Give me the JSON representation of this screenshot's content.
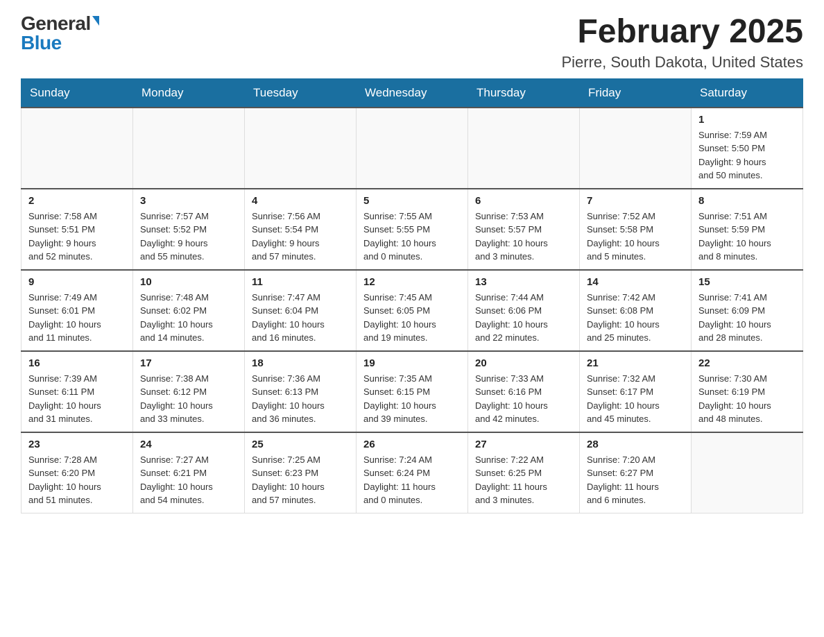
{
  "header": {
    "logo_general": "General",
    "logo_blue": "Blue",
    "title": "February 2025",
    "subtitle": "Pierre, South Dakota, United States"
  },
  "days_of_week": [
    "Sunday",
    "Monday",
    "Tuesday",
    "Wednesday",
    "Thursday",
    "Friday",
    "Saturday"
  ],
  "weeks": [
    [
      {
        "num": "",
        "info": ""
      },
      {
        "num": "",
        "info": ""
      },
      {
        "num": "",
        "info": ""
      },
      {
        "num": "",
        "info": ""
      },
      {
        "num": "",
        "info": ""
      },
      {
        "num": "",
        "info": ""
      },
      {
        "num": "1",
        "info": "Sunrise: 7:59 AM\nSunset: 5:50 PM\nDaylight: 9 hours\nand 50 minutes."
      }
    ],
    [
      {
        "num": "2",
        "info": "Sunrise: 7:58 AM\nSunset: 5:51 PM\nDaylight: 9 hours\nand 52 minutes."
      },
      {
        "num": "3",
        "info": "Sunrise: 7:57 AM\nSunset: 5:52 PM\nDaylight: 9 hours\nand 55 minutes."
      },
      {
        "num": "4",
        "info": "Sunrise: 7:56 AM\nSunset: 5:54 PM\nDaylight: 9 hours\nand 57 minutes."
      },
      {
        "num": "5",
        "info": "Sunrise: 7:55 AM\nSunset: 5:55 PM\nDaylight: 10 hours\nand 0 minutes."
      },
      {
        "num": "6",
        "info": "Sunrise: 7:53 AM\nSunset: 5:57 PM\nDaylight: 10 hours\nand 3 minutes."
      },
      {
        "num": "7",
        "info": "Sunrise: 7:52 AM\nSunset: 5:58 PM\nDaylight: 10 hours\nand 5 minutes."
      },
      {
        "num": "8",
        "info": "Sunrise: 7:51 AM\nSunset: 5:59 PM\nDaylight: 10 hours\nand 8 minutes."
      }
    ],
    [
      {
        "num": "9",
        "info": "Sunrise: 7:49 AM\nSunset: 6:01 PM\nDaylight: 10 hours\nand 11 minutes."
      },
      {
        "num": "10",
        "info": "Sunrise: 7:48 AM\nSunset: 6:02 PM\nDaylight: 10 hours\nand 14 minutes."
      },
      {
        "num": "11",
        "info": "Sunrise: 7:47 AM\nSunset: 6:04 PM\nDaylight: 10 hours\nand 16 minutes."
      },
      {
        "num": "12",
        "info": "Sunrise: 7:45 AM\nSunset: 6:05 PM\nDaylight: 10 hours\nand 19 minutes."
      },
      {
        "num": "13",
        "info": "Sunrise: 7:44 AM\nSunset: 6:06 PM\nDaylight: 10 hours\nand 22 minutes."
      },
      {
        "num": "14",
        "info": "Sunrise: 7:42 AM\nSunset: 6:08 PM\nDaylight: 10 hours\nand 25 minutes."
      },
      {
        "num": "15",
        "info": "Sunrise: 7:41 AM\nSunset: 6:09 PM\nDaylight: 10 hours\nand 28 minutes."
      }
    ],
    [
      {
        "num": "16",
        "info": "Sunrise: 7:39 AM\nSunset: 6:11 PM\nDaylight: 10 hours\nand 31 minutes."
      },
      {
        "num": "17",
        "info": "Sunrise: 7:38 AM\nSunset: 6:12 PM\nDaylight: 10 hours\nand 33 minutes."
      },
      {
        "num": "18",
        "info": "Sunrise: 7:36 AM\nSunset: 6:13 PM\nDaylight: 10 hours\nand 36 minutes."
      },
      {
        "num": "19",
        "info": "Sunrise: 7:35 AM\nSunset: 6:15 PM\nDaylight: 10 hours\nand 39 minutes."
      },
      {
        "num": "20",
        "info": "Sunrise: 7:33 AM\nSunset: 6:16 PM\nDaylight: 10 hours\nand 42 minutes."
      },
      {
        "num": "21",
        "info": "Sunrise: 7:32 AM\nSunset: 6:17 PM\nDaylight: 10 hours\nand 45 minutes."
      },
      {
        "num": "22",
        "info": "Sunrise: 7:30 AM\nSunset: 6:19 PM\nDaylight: 10 hours\nand 48 minutes."
      }
    ],
    [
      {
        "num": "23",
        "info": "Sunrise: 7:28 AM\nSunset: 6:20 PM\nDaylight: 10 hours\nand 51 minutes."
      },
      {
        "num": "24",
        "info": "Sunrise: 7:27 AM\nSunset: 6:21 PM\nDaylight: 10 hours\nand 54 minutes."
      },
      {
        "num": "25",
        "info": "Sunrise: 7:25 AM\nSunset: 6:23 PM\nDaylight: 10 hours\nand 57 minutes."
      },
      {
        "num": "26",
        "info": "Sunrise: 7:24 AM\nSunset: 6:24 PM\nDaylight: 11 hours\nand 0 minutes."
      },
      {
        "num": "27",
        "info": "Sunrise: 7:22 AM\nSunset: 6:25 PM\nDaylight: 11 hours\nand 3 minutes."
      },
      {
        "num": "28",
        "info": "Sunrise: 7:20 AM\nSunset: 6:27 PM\nDaylight: 11 hours\nand 6 minutes."
      },
      {
        "num": "",
        "info": ""
      }
    ]
  ]
}
